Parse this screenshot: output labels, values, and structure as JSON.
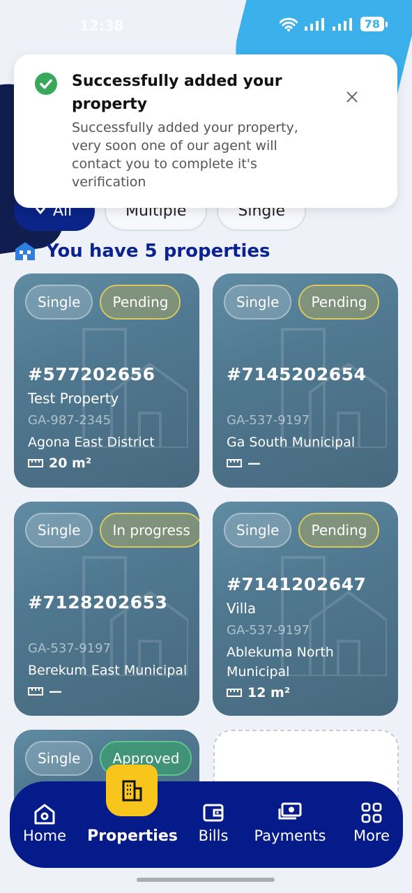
{
  "status_bar": {
    "time": "12:38",
    "battery": "78"
  },
  "toast": {
    "title": "Successfully added your property",
    "body": "Successfully added your property, very soon one of our agent will contact you to complete it's verification"
  },
  "filters": {
    "items": [
      {
        "label": "All"
      },
      {
        "label": "Multiple"
      },
      {
        "label": "Single"
      }
    ]
  },
  "section": {
    "title": "You have 5 properties"
  },
  "properties": [
    {
      "type": "Single",
      "status": "Pending",
      "id": "#577202656",
      "name": "Test Property",
      "code": "GA-987-2345",
      "district": "Agona East District",
      "size": "20 m²"
    },
    {
      "type": "Single",
      "status": "Pending",
      "id": "#7145202654",
      "name": "",
      "code": "GA-537-9197",
      "district": "Ga South Municipal",
      "size": "—"
    },
    {
      "type": "Single",
      "status": "In progress",
      "id": "#7128202653",
      "name": "",
      "code": "GA-537-9197",
      "district": "Berekum East Municipal",
      "size": "—"
    },
    {
      "type": "Single",
      "status": "Pending",
      "id": "#7141202647",
      "name": "Villa",
      "code": "GA-537-9197",
      "district": "Ablekuma North Municipal",
      "size": "12 m²"
    },
    {
      "type": "Single",
      "status": "Approved"
    }
  ],
  "nav": {
    "items": [
      {
        "label": "Home",
        "icon": "home-icon"
      },
      {
        "label": "Properties",
        "icon": "building-icon"
      },
      {
        "label": "Bills",
        "icon": "wallet-icon"
      },
      {
        "label": "Payments",
        "icon": "cash-icon"
      },
      {
        "label": "More",
        "icon": "grid-icon"
      }
    ],
    "active": "Properties"
  },
  "colors": {
    "primary": "#051b8a",
    "accent": "#f7c51c",
    "card": "#4f7890",
    "success": "#3aa85a",
    "sky": "#3bb0ea"
  }
}
